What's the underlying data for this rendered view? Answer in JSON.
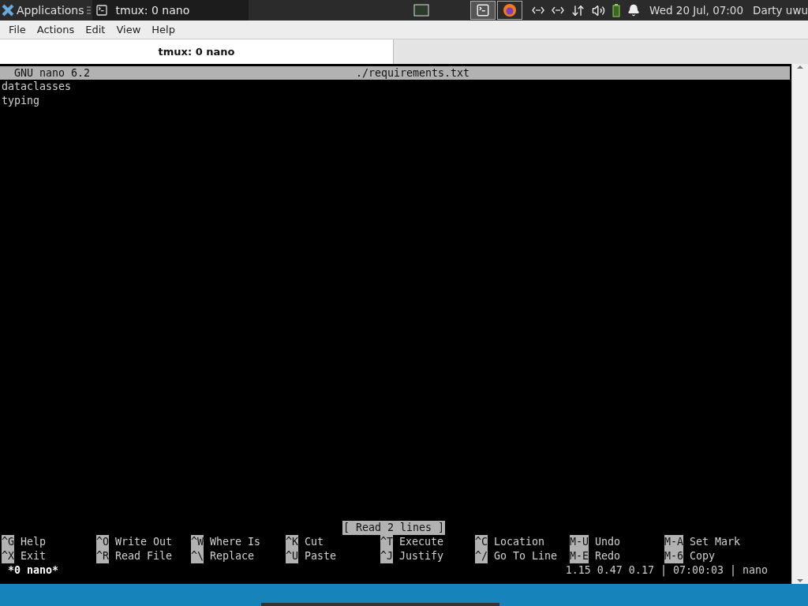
{
  "panel": {
    "app_menu": "Applications",
    "tasks": [
      {
        "title": "tmux: 0 nano",
        "selected": true
      }
    ],
    "clock": "Wed 20 Jul, 07:00",
    "user": "Darty uwu"
  },
  "window": {
    "menu": [
      "File",
      "Actions",
      "Edit",
      "View",
      "Help"
    ],
    "tabs": [
      {
        "label": "tmux: 0 nano",
        "selected": true
      }
    ]
  },
  "nano": {
    "version": "GNU nano 6.2",
    "filename": "./requirements.txt",
    "lines": [
      "dataclasses",
      "typing"
    ],
    "message": "[ Read 2 lines ]",
    "shortcuts": [
      [
        {
          "key": "^G",
          "label": "Help"
        },
        {
          "key": "^O",
          "label": "Write Out"
        },
        {
          "key": "^W",
          "label": "Where Is"
        },
        {
          "key": "^K",
          "label": "Cut"
        },
        {
          "key": "^T",
          "label": "Execute"
        },
        {
          "key": "^C",
          "label": "Location"
        },
        {
          "key": "M-U",
          "label": "Undo"
        },
        {
          "key": "M-A",
          "label": "Set Mark"
        }
      ],
      [
        {
          "key": "^X",
          "label": "Exit"
        },
        {
          "key": "^R",
          "label": "Read File"
        },
        {
          "key": "^\\",
          "label": "Replace"
        },
        {
          "key": "^U",
          "label": "Paste"
        },
        {
          "key": "^J",
          "label": "Justify"
        },
        {
          "key": "^/",
          "label": "Go To Line"
        },
        {
          "key": "M-E",
          "label": "Redo"
        },
        {
          "key": "M-6",
          "label": "Copy"
        }
      ]
    ]
  },
  "tmux": {
    "window": "*0 nano*",
    "status": "1.15 0.47 0.17 | 07:00:03 | nano"
  }
}
